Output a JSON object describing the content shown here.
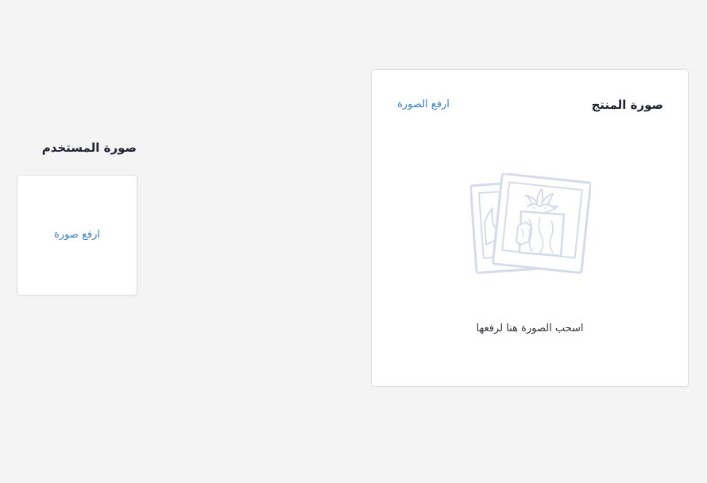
{
  "product_section": {
    "title": "صورة المنتج",
    "upload_link": "ارفع الصورة",
    "drop_hint": "اسحب الصورة هنا لرفعها",
    "illustration_icon": "photo-frames-illustration"
  },
  "user_section": {
    "title": "صورة المستخدم",
    "upload_label": "ارفع صورة"
  },
  "colors": {
    "background": "#f4f4f4",
    "card": "#ffffff",
    "link": "#3b7fc4",
    "heading": "#1f2430",
    "illustration_stroke": "#d5dbe8"
  }
}
